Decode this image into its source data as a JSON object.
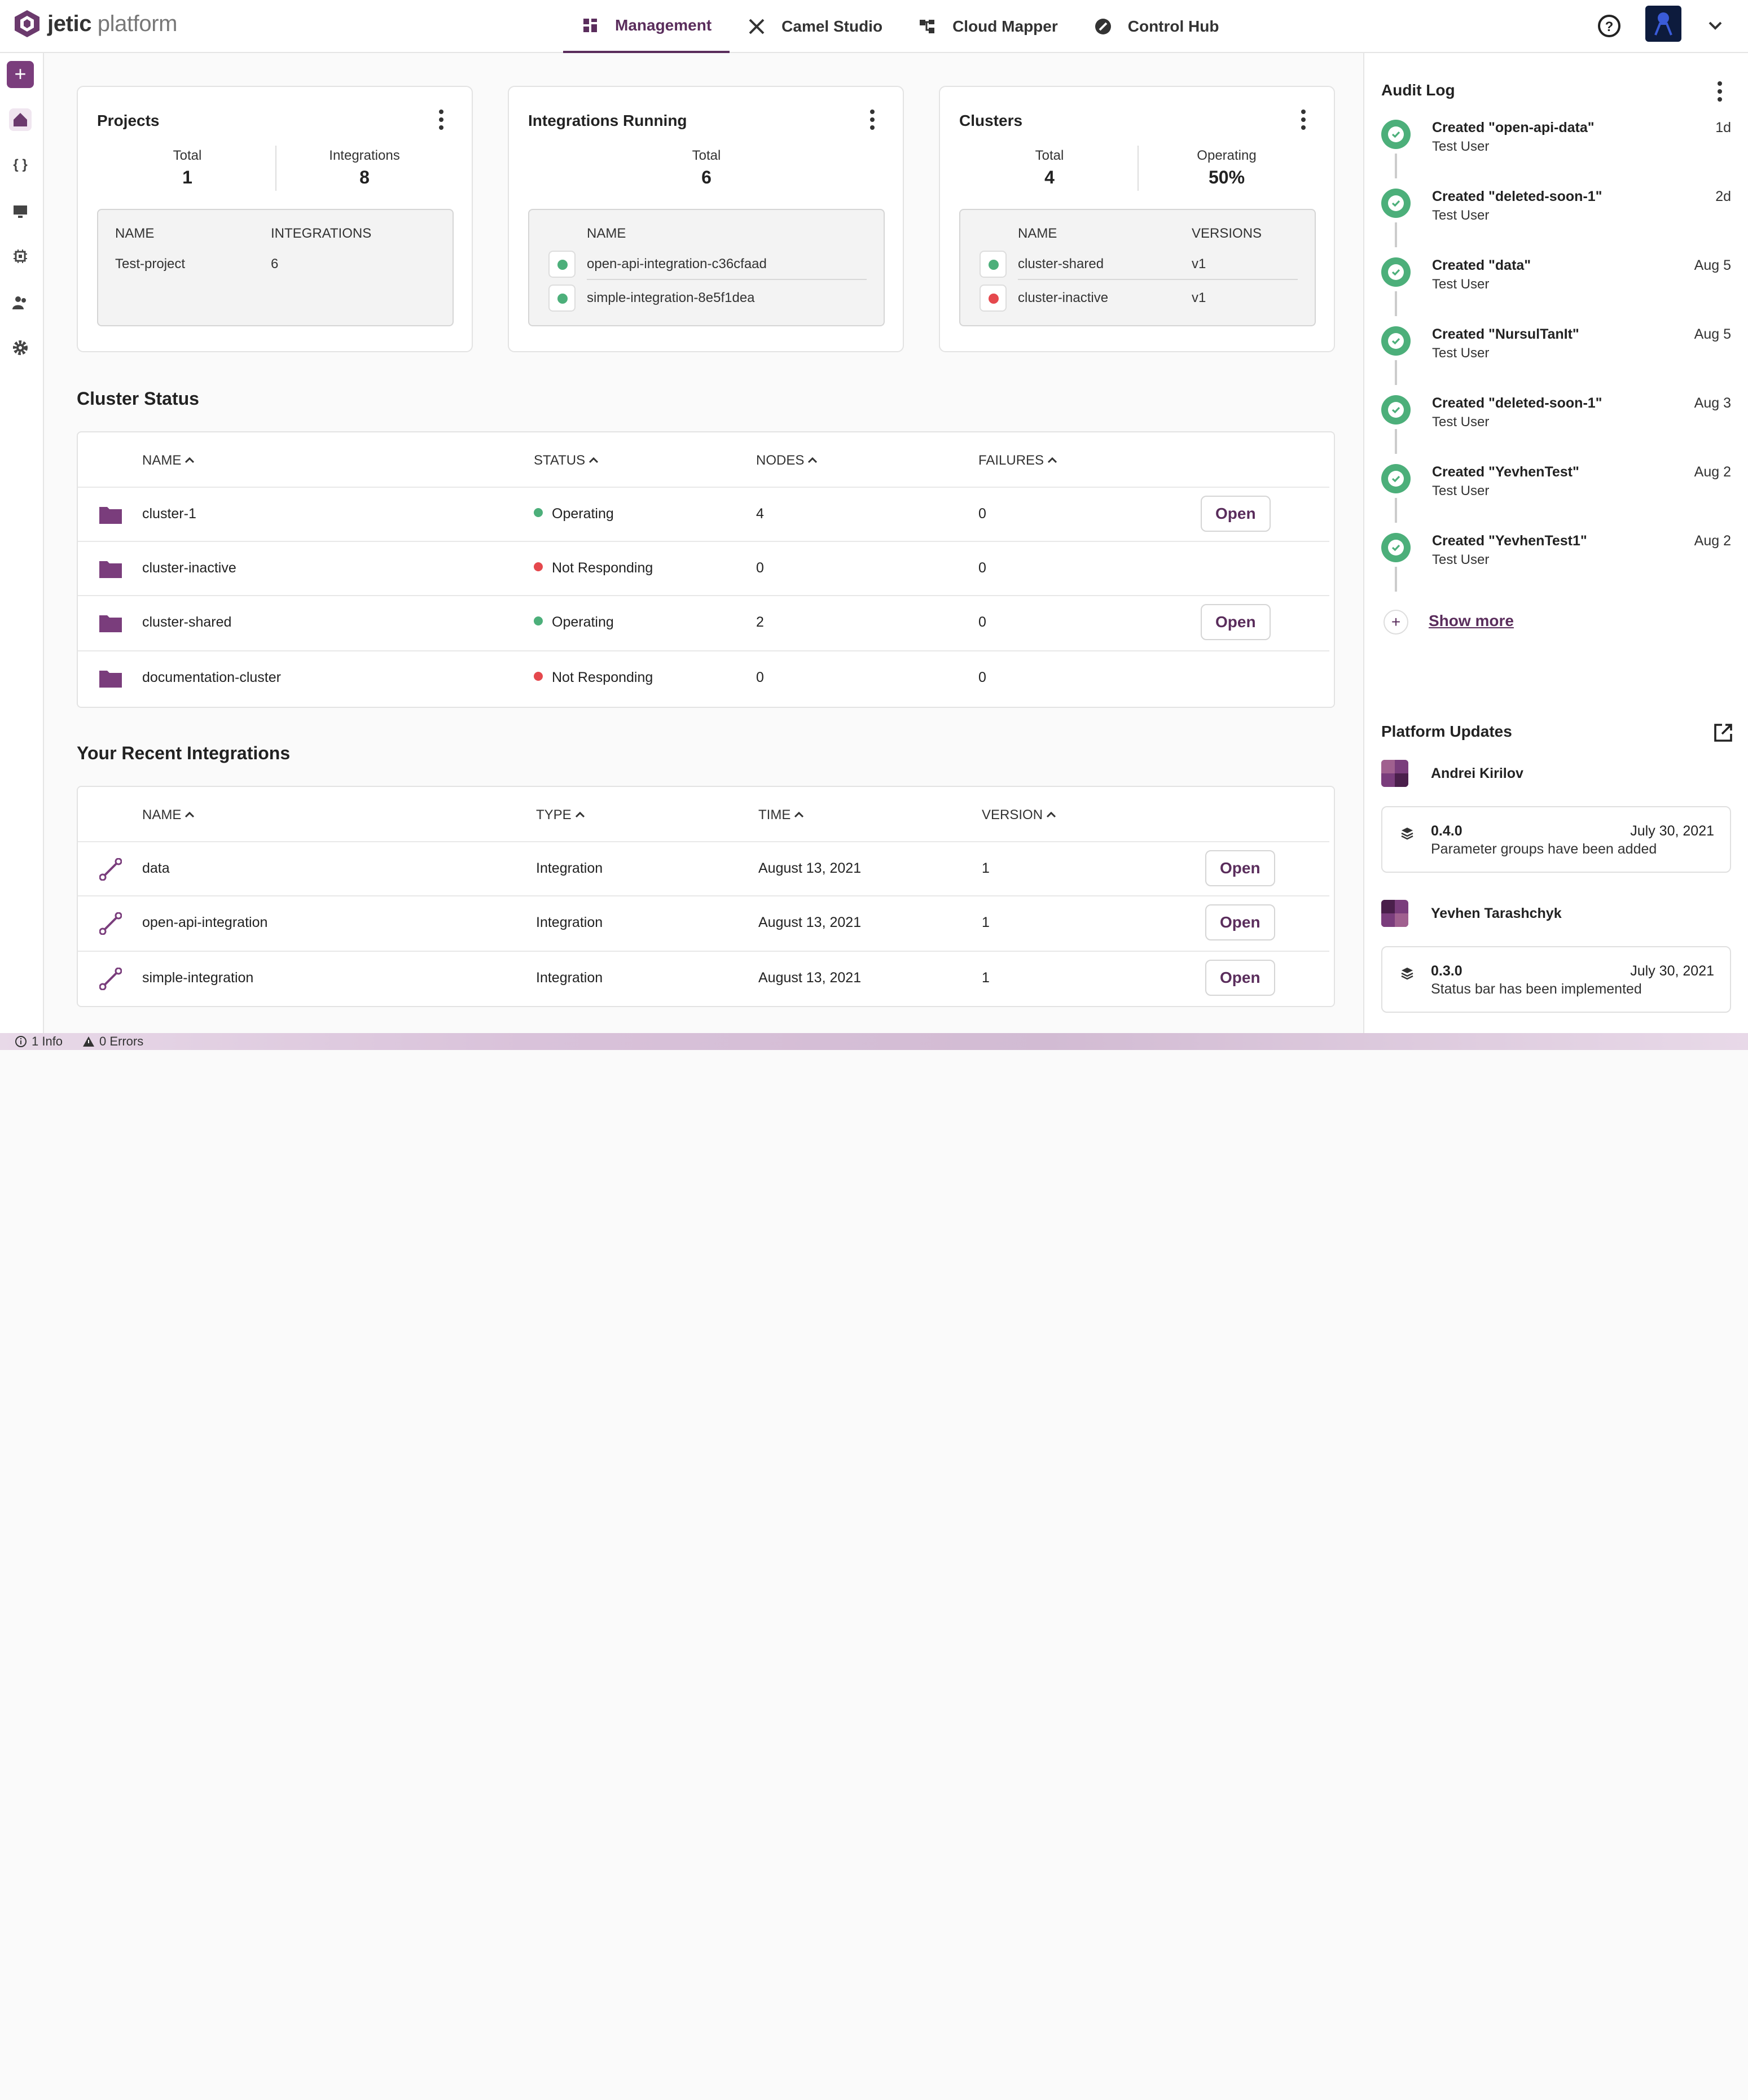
{
  "brand": {
    "name_bold": "jetic",
    "name_light": " platform"
  },
  "nav": {
    "tabs": [
      {
        "label": "Management"
      },
      {
        "label": "Camel Studio"
      },
      {
        "label": "Cloud Mapper"
      },
      {
        "label": "Control Hub"
      }
    ]
  },
  "sidebar": {
    "add_label": "+",
    "code_label": "{ }"
  },
  "cards": {
    "projects": {
      "title": "Projects",
      "stat1_label": "Total",
      "stat1_value": "1",
      "stat2_label": "Integrations",
      "stat2_value": "8",
      "col1": "NAME",
      "col2": "INTEGRATIONS",
      "rows": [
        {
          "name": "Test-project",
          "integrations": "6"
        }
      ]
    },
    "integrations": {
      "title": "Integrations Running",
      "stat1_label": "Total",
      "stat1_value": "6",
      "col1": "NAME",
      "rows": [
        {
          "name": "open-api-integration-c36cfaad",
          "status_color": "#4caf7a"
        },
        {
          "name": "simple-integration-8e5f1dea",
          "status_color": "#4caf7a"
        }
      ]
    },
    "clusters": {
      "title": "Clusters",
      "stat1_label": "Total",
      "stat1_value": "4",
      "stat2_label": "Operating",
      "stat2_value": "50%",
      "col1": "NAME",
      "col2": "VERSIONS",
      "rows": [
        {
          "name": "cluster-shared",
          "version": "v1",
          "status_color": "#4caf7a"
        },
        {
          "name": "cluster-inactive",
          "version": "v1",
          "status_color": "#e5484d"
        }
      ]
    }
  },
  "cluster_status": {
    "title": "Cluster Status",
    "headers": [
      "NAME",
      "STATUS",
      "NODES",
      "FAILURES"
    ],
    "rows": [
      {
        "name": "cluster-1",
        "status": "Operating",
        "status_color": "#4caf7a",
        "nodes": "4",
        "failures": "0",
        "action": "Open"
      },
      {
        "name": "cluster-inactive",
        "status": "Not Responding",
        "status_color": "#e5484d",
        "nodes": "0",
        "failures": "0",
        "action": ""
      },
      {
        "name": "cluster-shared",
        "status": "Operating",
        "status_color": "#4caf7a",
        "nodes": "2",
        "failures": "0",
        "action": "Open"
      },
      {
        "name": "documentation-cluster",
        "status": "Not Responding",
        "status_color": "#e5484d",
        "nodes": "0",
        "failures": "0",
        "action": ""
      }
    ]
  },
  "recent_integrations": {
    "title": "Your Recent Integrations",
    "headers": [
      "NAME",
      "TYPE",
      "TIME",
      "VERSION"
    ],
    "rows": [
      {
        "name": "data",
        "type": "Integration",
        "time": "August 13, 2021",
        "version": "1",
        "action": "Open"
      },
      {
        "name": "open-api-integration",
        "type": "Integration",
        "time": "August 13, 2021",
        "version": "1",
        "action": "Open"
      },
      {
        "name": "simple-integration",
        "type": "Integration",
        "time": "August 13, 2021",
        "version": "1",
        "action": "Open"
      }
    ]
  },
  "audit_log": {
    "title": "Audit Log",
    "items": [
      {
        "title": "Created \"open-api-data\"",
        "user": "Test User",
        "time": "1d"
      },
      {
        "title": "Created \"deleted-soon-1\"",
        "user": "Test User",
        "time": "2d"
      },
      {
        "title": "Created \"data\"",
        "user": "Test User",
        "time": "Aug 5"
      },
      {
        "title": "Created \"NursulTanIt\"",
        "user": "Test User",
        "time": "Aug 5"
      },
      {
        "title": "Created \"deleted-soon-1\"",
        "user": "Test User",
        "time": "Aug 3"
      },
      {
        "title": "Created \"YevhenTest\"",
        "user": "Test User",
        "time": "Aug 2"
      },
      {
        "title": "Created \"YevhenTest1\"",
        "user": "Test User",
        "time": "Aug 2"
      }
    ],
    "show_more": "Show more"
  },
  "platform_updates": {
    "title": "Platform Updates",
    "items": [
      {
        "author": "Andrei Kirilov",
        "version": "0.4.0",
        "date": "July 30, 2021",
        "description": "Parameter groups have been added"
      },
      {
        "author": "Yevhen Tarashchyk",
        "version": "0.3.0",
        "date": "July 30, 2021",
        "description": "Status bar has been implemented"
      }
    ]
  },
  "statusbar": {
    "info": "1 Info",
    "errors": "0 Errors"
  },
  "colors": {
    "accent": "#5a2d5c",
    "ok": "#4caf7a",
    "error": "#e5484d"
  }
}
